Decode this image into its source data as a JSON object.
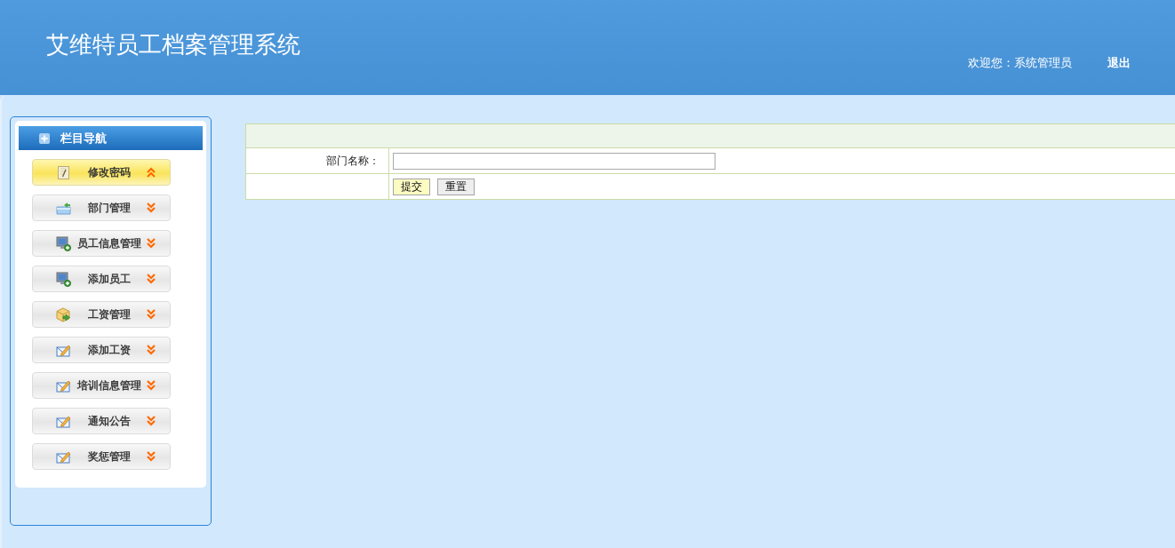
{
  "header": {
    "title": "艾维特员工档案管理系统",
    "welcome": "欢迎您：系统管理员",
    "logout": "退出"
  },
  "sidebar": {
    "title": "栏目导航",
    "items": [
      {
        "label": "修改密码",
        "kind": "note",
        "selected": true
      },
      {
        "label": "部门管理",
        "kind": "folder",
        "selected": false
      },
      {
        "label": "员工信息管理",
        "kind": "computer",
        "selected": false
      },
      {
        "label": "添加员工",
        "kind": "computer",
        "selected": false
      },
      {
        "label": "工资管理",
        "kind": "package",
        "selected": false
      },
      {
        "label": "添加工资",
        "kind": "mail",
        "selected": false
      },
      {
        "label": "培训信息管理",
        "kind": "mail",
        "selected": false
      },
      {
        "label": "通知公告",
        "kind": "mail",
        "selected": false
      },
      {
        "label": "奖惩管理",
        "kind": "mail",
        "selected": false
      }
    ]
  },
  "form": {
    "fields": [
      {
        "label": "部门名称："
      }
    ],
    "buttons": [
      {
        "label": "提交",
        "kind": "submit"
      },
      {
        "label": "重置",
        "kind": "reset"
      }
    ]
  }
}
